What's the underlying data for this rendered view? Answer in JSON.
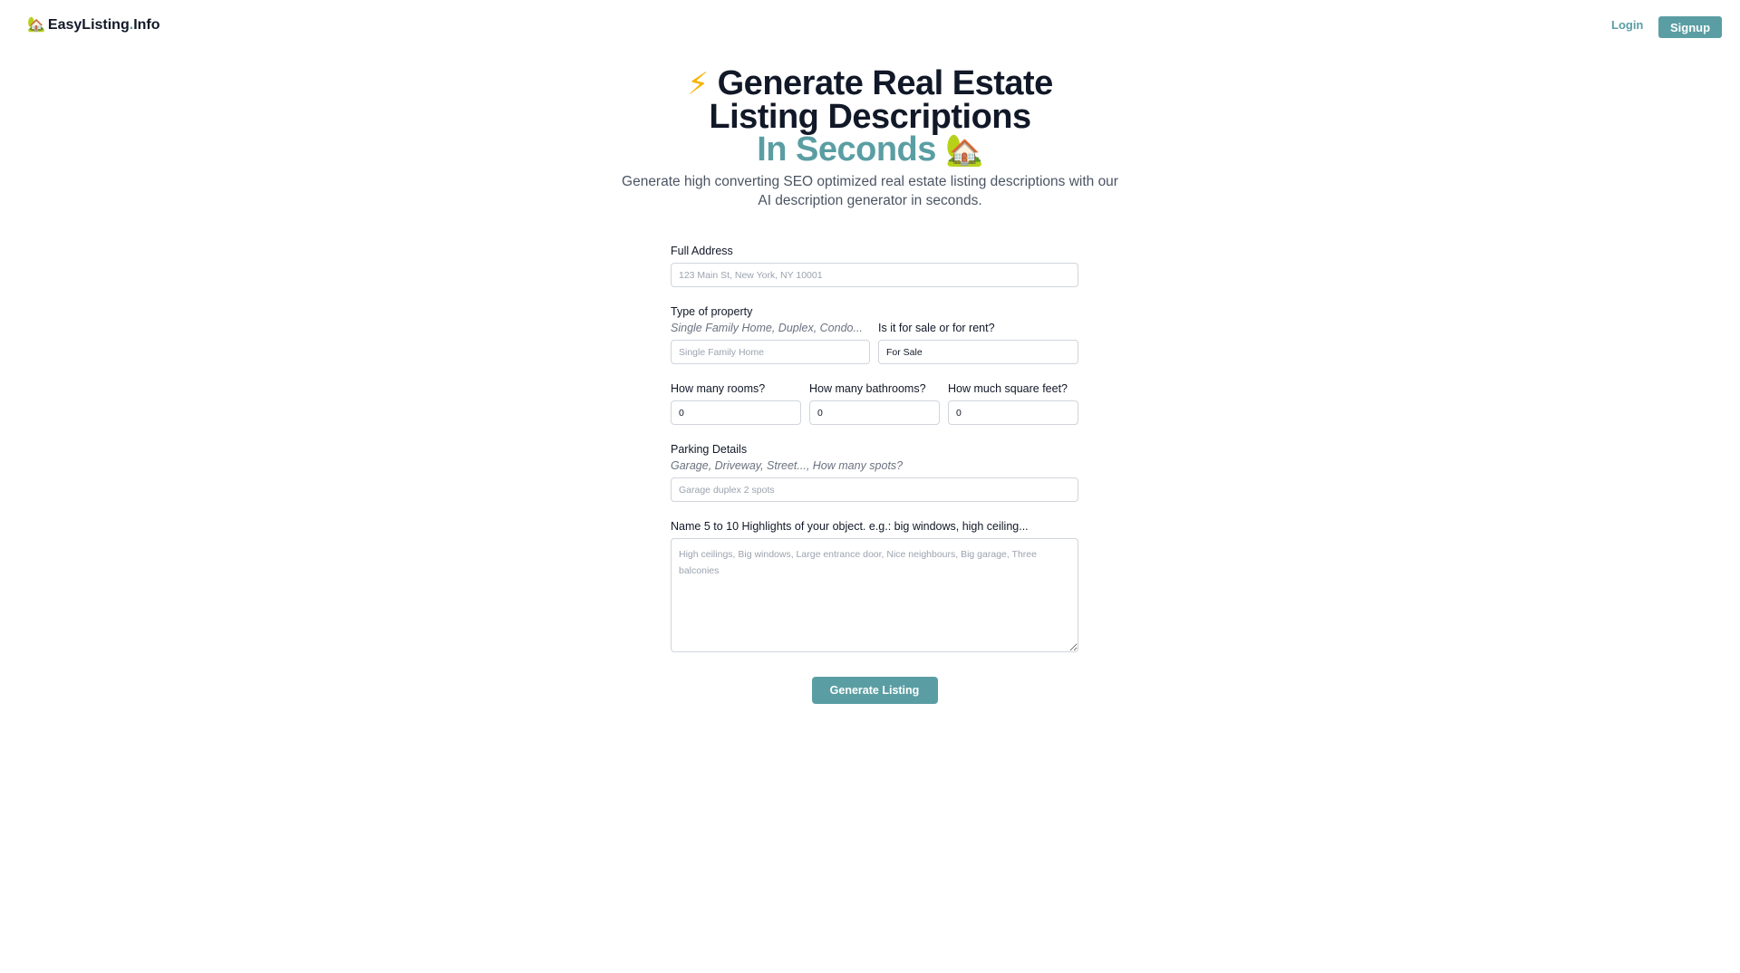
{
  "nav": {
    "logo_name": "EasyListing",
    "logo_dot": ".",
    "logo_suffix": "Info",
    "logo_icon": "🏡",
    "login": "Login",
    "signup": "Signup"
  },
  "hero": {
    "bolt_icon": "⚡",
    "title_line1": "Generate Real Estate",
    "title_line2": "Listing Descriptions",
    "title_accent": "In Seconds",
    "house_icon": "🏡",
    "subtitle": "Generate high converting SEO optimized real estate listing descriptions with our AI description generator in seconds."
  },
  "form": {
    "address": {
      "label": "Full Address",
      "placeholder": "123 Main St, New York, NY 10001",
      "value": ""
    },
    "property_type": {
      "label": "Type of property",
      "hint": "Single Family Home, Duplex, Condo...",
      "placeholder": "Single Family Home",
      "value": ""
    },
    "sale_rent": {
      "label": "Is it for sale or for rent?",
      "value": "For Sale"
    },
    "rooms": {
      "label": "How many rooms?",
      "value": "0"
    },
    "bathrooms": {
      "label": "How many bathrooms?",
      "value": "0"
    },
    "sqft": {
      "label": "How much square feet?",
      "value": "0"
    },
    "parking": {
      "label": "Parking Details",
      "hint": "Garage, Driveway, Street..., How many spots?",
      "placeholder": "Garage duplex 2 spots",
      "value": ""
    },
    "highlights": {
      "label": "Name 5 to 10 Highlights of your object. e.g.: big windows, high ceiling...",
      "placeholder": "High ceilings, Big windows, Large entrance door, Nice neighbours, Big garage, Three balconies",
      "value": ""
    },
    "submit": "Generate Listing"
  },
  "colors": {
    "accent": "#5a9ea3",
    "bolt": "#f5b301",
    "text": "#111827"
  }
}
